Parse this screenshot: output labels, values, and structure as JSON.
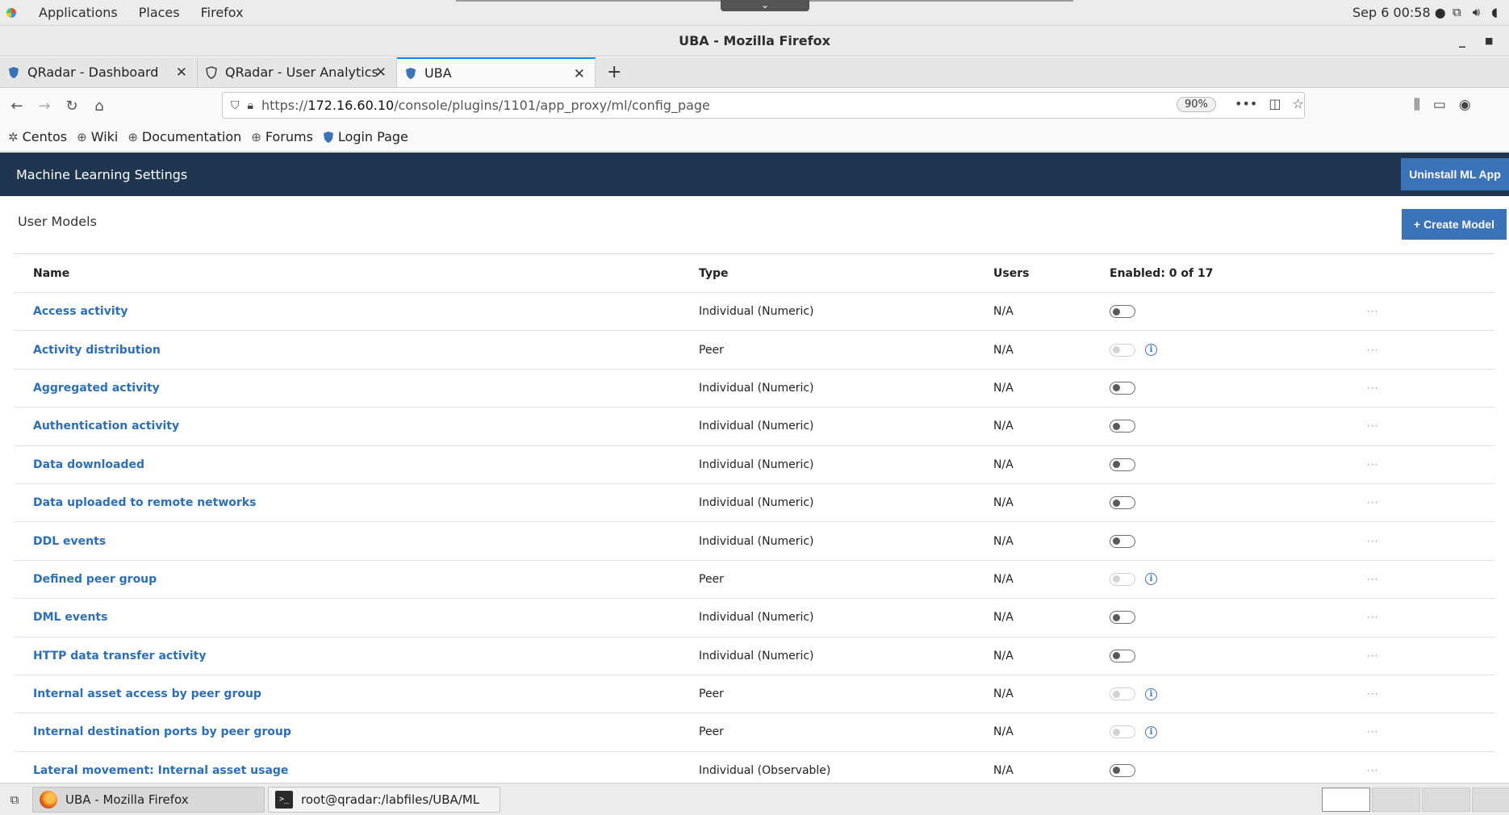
{
  "gnome": {
    "applications": "Applications",
    "places": "Places",
    "firefox": "Firefox",
    "clock": "Sep 6  00:58 ●"
  },
  "window": {
    "title": "UBA - Mozilla Firefox"
  },
  "tabs": [
    {
      "label": "QRadar - Dashboard"
    },
    {
      "label": "QRadar - User Analytics"
    },
    {
      "label": "UBA"
    }
  ],
  "nav": {
    "url_prefix": "https://",
    "url_host": "172.16.60.10",
    "url_path": "/console/plugins/1101/app_proxy/ml/config_page",
    "zoom": "90%"
  },
  "bookmarks": [
    {
      "label": "Centos",
      "icon": "centos-icon"
    },
    {
      "label": "Wiki",
      "icon": "globe-icon"
    },
    {
      "label": "Documentation",
      "icon": "globe-icon"
    },
    {
      "label": "Forums",
      "icon": "globe-icon"
    },
    {
      "label": "Login Page",
      "icon": "qradar-icon"
    }
  ],
  "app": {
    "title": "Machine Learning Settings",
    "uninstall_label": "Uninstall ML App",
    "section_title": "User Models",
    "create_label": "+ Create Model"
  },
  "table": {
    "headers": {
      "name": "Name",
      "type": "Type",
      "users": "Users",
      "enabled": "Enabled: 0 of 17"
    },
    "rows": [
      {
        "name": "Access activity",
        "type": "Individual (Numeric)",
        "users": "N/A",
        "enabled": false,
        "toggle_disabled": false,
        "info": false
      },
      {
        "name": "Activity distribution",
        "type": "Peer",
        "users": "N/A",
        "enabled": false,
        "toggle_disabled": true,
        "info": true
      },
      {
        "name": "Aggregated activity",
        "type": "Individual (Numeric)",
        "users": "N/A",
        "enabled": false,
        "toggle_disabled": false,
        "info": false
      },
      {
        "name": "Authentication activity",
        "type": "Individual (Numeric)",
        "users": "N/A",
        "enabled": false,
        "toggle_disabled": false,
        "info": false
      },
      {
        "name": "Data downloaded",
        "type": "Individual (Numeric)",
        "users": "N/A",
        "enabled": false,
        "toggle_disabled": false,
        "info": false
      },
      {
        "name": "Data uploaded to remote networks",
        "type": "Individual (Numeric)",
        "users": "N/A",
        "enabled": false,
        "toggle_disabled": false,
        "info": false
      },
      {
        "name": "DDL events",
        "type": "Individual (Numeric)",
        "users": "N/A",
        "enabled": false,
        "toggle_disabled": false,
        "info": false
      },
      {
        "name": "Defined peer group",
        "type": "Peer",
        "users": "N/A",
        "enabled": false,
        "toggle_disabled": true,
        "info": true
      },
      {
        "name": "DML events",
        "type": "Individual (Numeric)",
        "users": "N/A",
        "enabled": false,
        "toggle_disabled": false,
        "info": false
      },
      {
        "name": "HTTP data transfer activity",
        "type": "Individual (Numeric)",
        "users": "N/A",
        "enabled": false,
        "toggle_disabled": false,
        "info": false
      },
      {
        "name": "Internal asset access by peer group",
        "type": "Peer",
        "users": "N/A",
        "enabled": false,
        "toggle_disabled": true,
        "info": true
      },
      {
        "name": "Internal destination ports by peer group",
        "type": "Peer",
        "users": "N/A",
        "enabled": false,
        "toggle_disabled": true,
        "info": true
      },
      {
        "name": "Lateral movement: Internal asset usage",
        "type": "Individual (Observable)",
        "users": "N/A",
        "enabled": false,
        "toggle_disabled": false,
        "info": false
      }
    ],
    "more_glyph": "···",
    "info_glyph": "i"
  },
  "taskbar": {
    "tasks": [
      {
        "label": "UBA - Mozilla Firefox"
      },
      {
        "label": "root@qradar:/labfiles/UBA/ML"
      }
    ]
  },
  "colors": {
    "header_bg": "#1f3550",
    "primary": "#3b73b9",
    "link": "#2d6fb7"
  }
}
